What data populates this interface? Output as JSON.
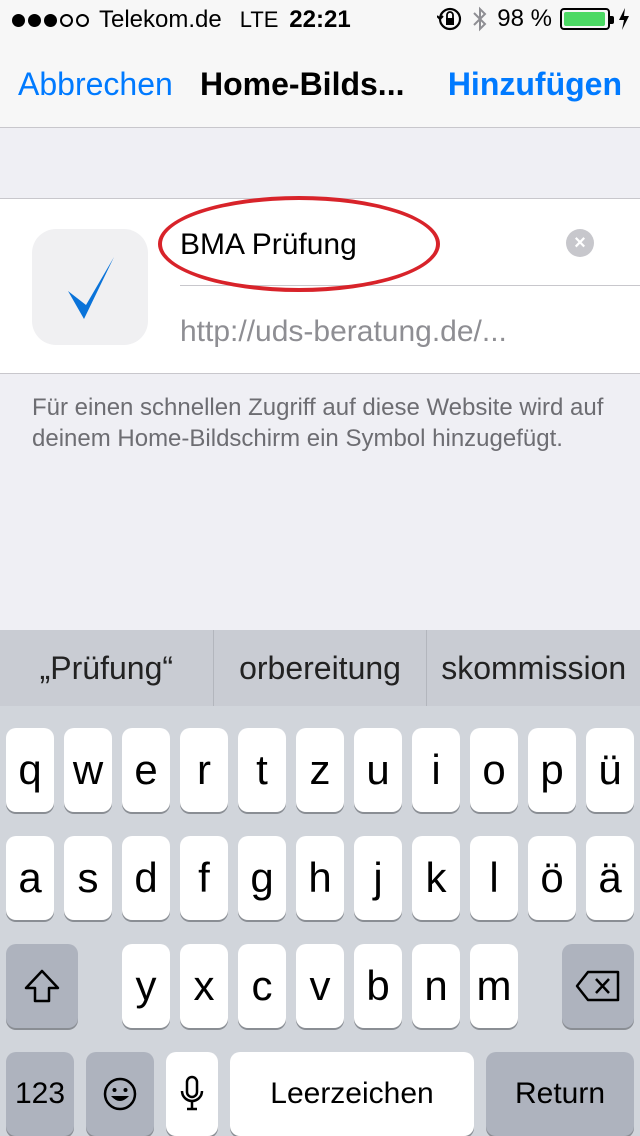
{
  "status_bar": {
    "carrier": "Telekom.de",
    "network": "LTE",
    "time": "22:21",
    "battery_percent": "98 %",
    "battery_level": 0.98,
    "battery_color": "#4cd964"
  },
  "nav": {
    "cancel_label": "Abbrechen",
    "title": "Home-Bilds...",
    "add_label": "Hinzufügen",
    "accent_color": "#007aff"
  },
  "form": {
    "name_value": "BMA Prüfung",
    "url": "http://uds-beratung.de/...",
    "app_icon": "checkmark-icon"
  },
  "hint": "Für einen schnellen Zugriff auf diese Website wird auf deinem Home-Bildschirm ein Symbol hinzugefügt.",
  "suggestions": [
    "„Prüfung“",
    "orbereitung",
    "skommission"
  ],
  "keyboard": {
    "row1": [
      "q",
      "w",
      "e",
      "r",
      "t",
      "z",
      "u",
      "i",
      "o",
      "p",
      "ü"
    ],
    "row2": [
      "a",
      "s",
      "d",
      "f",
      "g",
      "h",
      "j",
      "k",
      "l",
      "ö",
      "ä"
    ],
    "row3": [
      "y",
      "x",
      "c",
      "v",
      "b",
      "n",
      "m"
    ],
    "shift_icon": "shift-icon",
    "delete_icon": "backspace-icon",
    "numbers_label": "123",
    "emoji_icon": "emoji-icon",
    "mic_icon": "microphone-icon",
    "space_label": "Leerzeichen",
    "return_label": "Return"
  }
}
